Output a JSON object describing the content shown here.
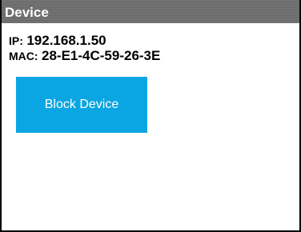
{
  "window": {
    "title": "Device"
  },
  "device": {
    "ip_label": "IP:",
    "ip_value": "192.168.1.50",
    "mac_label": "MAC:",
    "mac_value": "28-E1-4C-59-26-3E"
  },
  "actions": {
    "block_label": "Block Device"
  },
  "colors": {
    "title_bar": "#6e6e6e",
    "button": "#0aa6e3",
    "button_text": "#ffffff",
    "border": "#000000"
  }
}
